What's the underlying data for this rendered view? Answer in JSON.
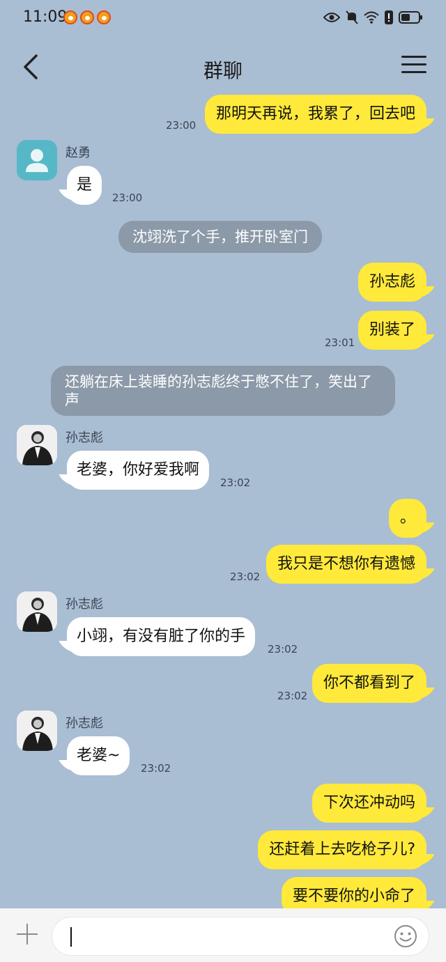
{
  "status_bar": {
    "time": "11:09"
  },
  "nav": {
    "title": "群聊"
  },
  "messages": [
    {
      "type": "out",
      "text": "那明天再说，我累了，回去吧",
      "time": "23:00"
    },
    {
      "type": "in",
      "sender": "赵勇",
      "text": "是",
      "time": "23:00"
    },
    {
      "type": "narration",
      "text": "沈翊洗了个手，推开卧室门"
    },
    {
      "type": "out",
      "text": "孙志彪"
    },
    {
      "type": "out",
      "text": "别装了",
      "time": "23:01"
    },
    {
      "type": "narration",
      "text": "还躺在床上装睡的孙志彪终于憋不住了，笑出了声"
    },
    {
      "type": "in",
      "sender": "孙志彪",
      "text": "老婆，你好爱我啊",
      "time": "23:02"
    },
    {
      "type": "out",
      "text": "。"
    },
    {
      "type": "out",
      "text": "我只是不想你有遗憾",
      "time": "23:02"
    },
    {
      "type": "in",
      "sender": "孙志彪",
      "text": "小翊，有没有脏了你的手",
      "time": "23:02"
    },
    {
      "type": "out",
      "text": "你不都看到了",
      "time": "23:02"
    },
    {
      "type": "in",
      "sender": "孙志彪",
      "text": "老婆~",
      "time": "23:02"
    },
    {
      "type": "out",
      "text": "下次还冲动吗"
    },
    {
      "type": "out",
      "text": "还赶着上去吃枪子儿?"
    },
    {
      "type": "out",
      "text": "要不要你的小命了"
    }
  ],
  "colors": {
    "background": "#a9bdd3",
    "outgoing_bubble": "#ffe93a",
    "incoming_bubble": "#ffffff",
    "narration_bubble": "#8b99a8"
  },
  "icons": {
    "back": "chevron-left-icon",
    "menu": "hamburger-menu-icon",
    "attach": "plus-icon",
    "emoji": "smiley-face-icon"
  }
}
